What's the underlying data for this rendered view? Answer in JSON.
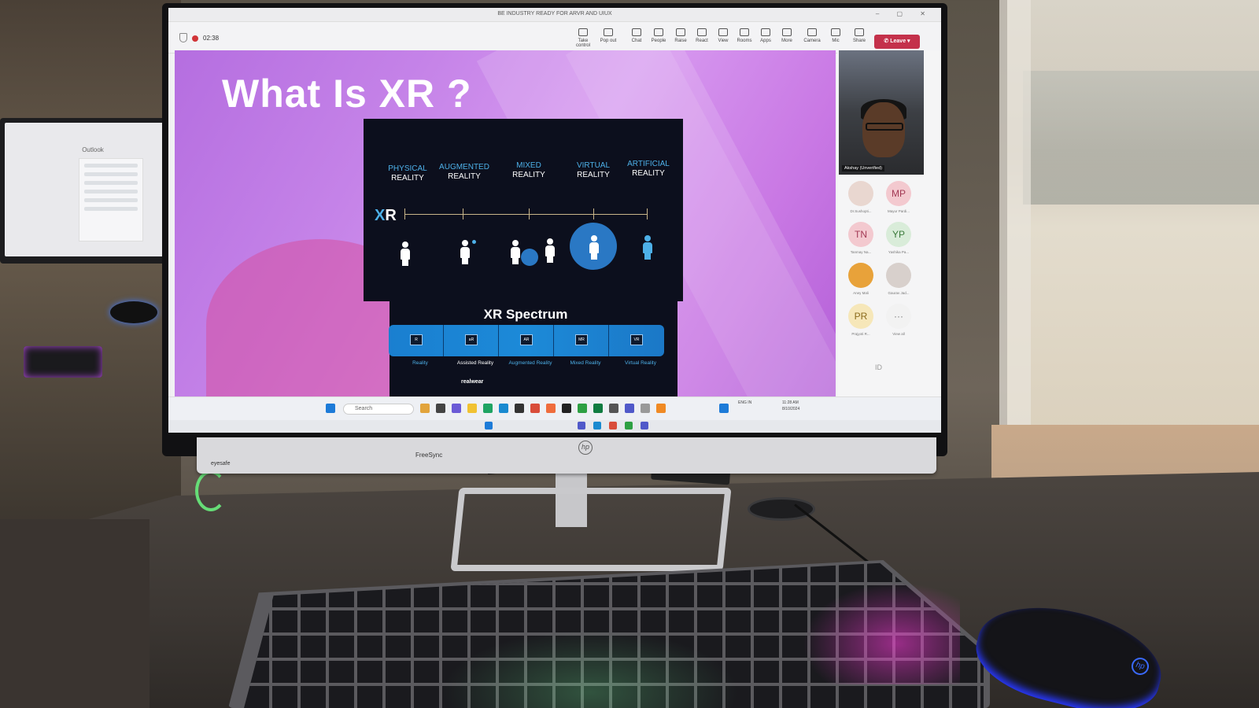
{
  "meeting": {
    "window_title": "BE INDUSTRY READY FOR ARVR AND UIUX",
    "timer": "02:38",
    "toolbar": [
      "Take control",
      "Pop out",
      "Chat",
      "People",
      "Raise",
      "React",
      "View",
      "Rooms",
      "Apps",
      "More",
      "Camera",
      "Mic",
      "Share"
    ],
    "leave_label": "Leave",
    "presenter_name": "Akshay (Unverified)",
    "participants": [
      {
        "initials": "",
        "name": "Dr.Sushopti...",
        "color": "#e9d7d0"
      },
      {
        "initials": "MP",
        "name": "Mayur Pardi...",
        "color": "#f3c9cf"
      },
      {
        "initials": "TN",
        "name": "Tanmay Na...",
        "color": "#f3c9cf"
      },
      {
        "initials": "YP",
        "name": "Yashika Pa...",
        "color": "#d9ecd9"
      },
      {
        "initials": "",
        "name": "Aney Mali",
        "color": "#e8a23a"
      },
      {
        "initials": "",
        "name": "Gaurav Jad...",
        "color": "#d8d0cc"
      },
      {
        "initials": "PR",
        "name": "Prajyoti R...",
        "color": "#f6e7b9"
      },
      {
        "initials": "···",
        "name": "View all",
        "color": "#f2f2f2"
      }
    ],
    "id_label": "ID"
  },
  "slide": {
    "title": "What Is XR ?",
    "columns": [
      {
        "top": "PHYSICAL",
        "bottom": "REALITY"
      },
      {
        "top": "AUGMENTED",
        "bottom": "REALITY"
      },
      {
        "top": "MIXED",
        "bottom": "REALITY"
      },
      {
        "top": "VIRTUAL",
        "bottom": "REALITY"
      },
      {
        "top": "ARTIFICIAL",
        "bottom": "REALITY"
      }
    ],
    "xr_x": "X",
    "xr_r": "R",
    "spectrum_title": "XR Spectrum",
    "spectrum": [
      {
        "chip": "R",
        "label": "Reality",
        "white": false
      },
      {
        "chip": "aR",
        "label": "Assisted Reality",
        "white": true
      },
      {
        "chip": "AR",
        "label": "Augmented Reality",
        "white": false
      },
      {
        "chip": "MR",
        "label": "Mixed Reality",
        "white": false
      },
      {
        "chip": "VR",
        "label": "Virtual Reality",
        "white": false
      }
    ],
    "brand": "realwear"
  },
  "taskbar": {
    "search_placeholder": "Search",
    "lang": "ENG IN",
    "time": "11:28 AM",
    "date": "8/10/2024"
  },
  "monitor": {
    "brand": "hp",
    "freesync": "FreeSync",
    "eyesafe": "eyesafe"
  },
  "side_monitor": {
    "app": "Outlook"
  },
  "colors": {
    "slide_purple": "#c583e8",
    "xr_blue": "#4db0e8",
    "leave_red": "#c4314b"
  }
}
